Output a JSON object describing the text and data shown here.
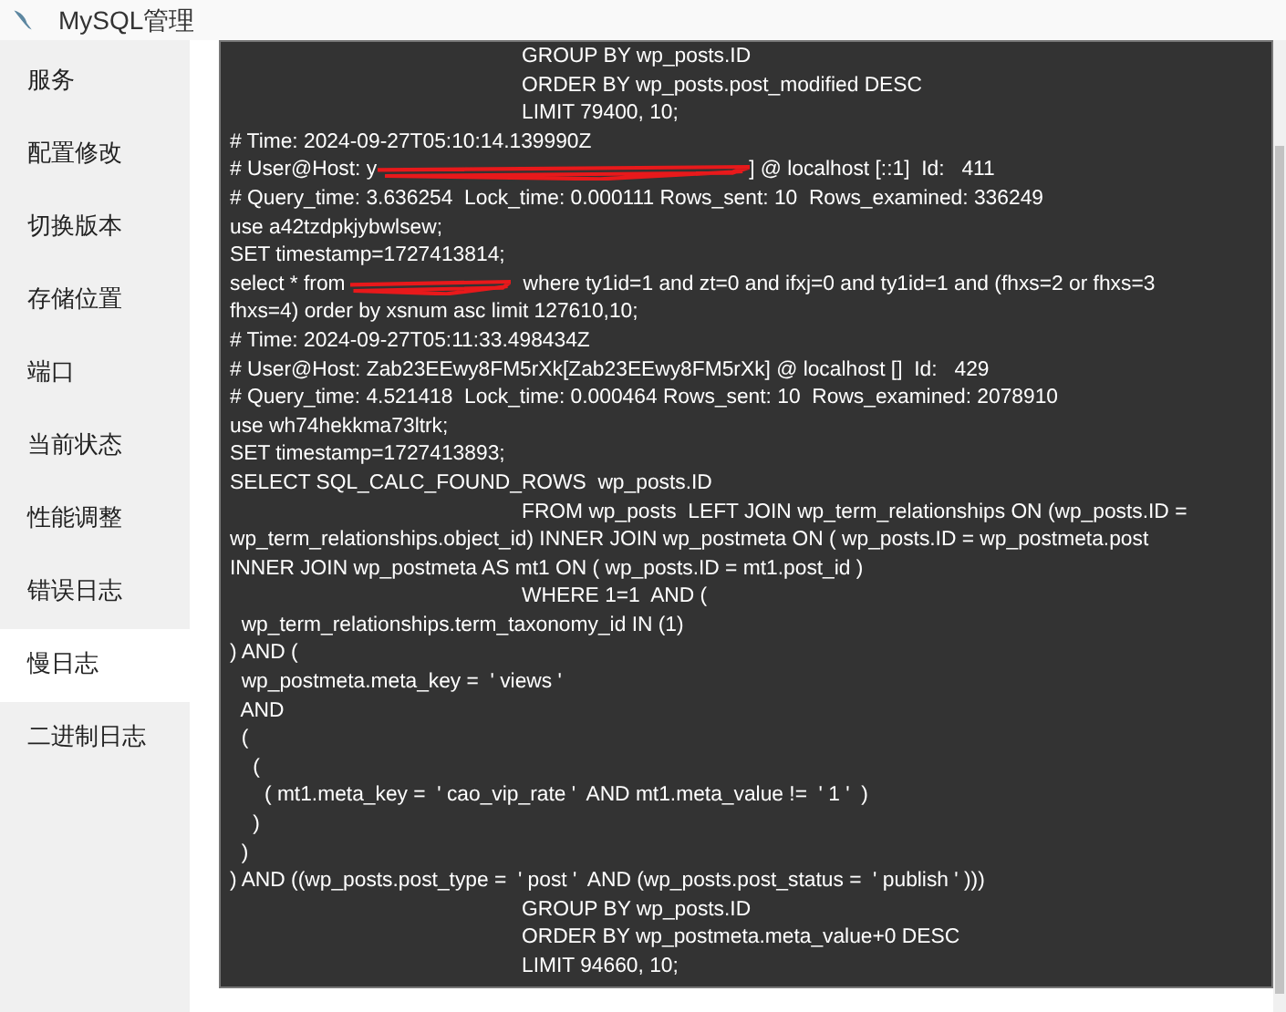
{
  "window": {
    "title": "MySQL管理"
  },
  "sidebar": {
    "items": [
      {
        "label": "服务",
        "selected": false
      },
      {
        "label": "配置修改",
        "selected": false
      },
      {
        "label": "切换版本",
        "selected": false
      },
      {
        "label": "存储位置",
        "selected": false
      },
      {
        "label": "端口",
        "selected": false
      },
      {
        "label": "当前状态",
        "selected": false
      },
      {
        "label": "性能调整",
        "selected": false
      },
      {
        "label": "错误日志",
        "selected": false
      },
      {
        "label": "慢日志",
        "selected": true
      },
      {
        "label": "二进制日志",
        "selected": false
      }
    ]
  },
  "log": {
    "lines": [
      [
        {
          "kind": "text",
          "text": "\t\t\t\tGROUP BY wp_posts.ID"
        }
      ],
      [
        {
          "kind": "text",
          "text": "\t\t\t\tORDER BY wp_posts.post_modified DESC"
        }
      ],
      [
        {
          "kind": "text",
          "text": "\t\t\t\tLIMIT 79400, 10;"
        }
      ],
      [
        {
          "kind": "text",
          "text": "# Time: 2024-09-27T05:10:14.139990Z"
        }
      ],
      [
        {
          "kind": "text",
          "text": "# User@Host: y"
        },
        {
          "kind": "long-redaction"
        },
        {
          "kind": "text",
          "text": "] @ localhost [::1]  Id:   411"
        }
      ],
      [
        {
          "kind": "text",
          "text": "# Query_time: 3.636254  Lock_time: 0.000111 Rows_sent: 10  Rows_examined: 336249"
        }
      ],
      [
        {
          "kind": "text",
          "text": "use a42tzdpkjybwlsew;"
        }
      ],
      [
        {
          "kind": "text",
          "text": "SET timestamp=1727413814;"
        }
      ],
      [
        {
          "kind": "text",
          "text": "select * from "
        },
        {
          "kind": "short-redaction"
        },
        {
          "kind": "text",
          "text": "  where ty1id=1 and zt=0 and ifxj=0 and ty1id=1 and (fhxs=2 or fhxs=3"
        }
      ],
      [
        {
          "kind": "text",
          "text": "fhxs=4) order by xsnum asc limit 127610,10;"
        }
      ],
      [
        {
          "kind": "text",
          "text": "# Time: 2024-09-27T05:11:33.498434Z"
        }
      ],
      [
        {
          "kind": "text",
          "text": "# User@Host: Zab23EEwy8FM5rXk[Zab23EEwy8FM5rXk] @ localhost []  Id:   429"
        }
      ],
      [
        {
          "kind": "text",
          "text": "# Query_time: 4.521418  Lock_time: 0.000464 Rows_sent: 10  Rows_examined: 2078910"
        }
      ],
      [
        {
          "kind": "text",
          "text": "use wh74hekkma73ltrk;"
        }
      ],
      [
        {
          "kind": "text",
          "text": "SET timestamp=1727413893;"
        }
      ],
      [
        {
          "kind": "text",
          "text": "SELECT SQL_CALC_FOUND_ROWS  wp_posts.ID"
        }
      ],
      [
        {
          "kind": "text",
          "text": "\t\t\t\tFROM wp_posts  LEFT JOIN wp_term_relationships ON (wp_posts.ID ="
        }
      ],
      [
        {
          "kind": "text",
          "text": "wp_term_relationships.object_id) INNER JOIN wp_postmeta ON ( wp_posts.ID = wp_postmeta.post"
        }
      ],
      [
        {
          "kind": "text",
          "text": "INNER JOIN wp_postmeta AS mt1 ON ( wp_posts.ID = mt1.post_id )"
        }
      ],
      [
        {
          "kind": "text",
          "text": "\t\t\t\tWHERE 1=1  AND ("
        }
      ],
      [
        {
          "kind": "text",
          "text": "  wp_term_relationships.term_taxonomy_id IN (1)"
        }
      ],
      [
        {
          "kind": "text",
          "text": ") AND ("
        }
      ],
      [
        {
          "kind": "text",
          "text": "  wp_postmeta.meta_key =  ' views '"
        }
      ],
      [
        {
          "kind": "text",
          "text": "  AND"
        }
      ],
      [
        {
          "kind": "text",
          "text": "  ("
        }
      ],
      [
        {
          "kind": "text",
          "text": "    ("
        }
      ],
      [
        {
          "kind": "text",
          "text": "      ( mt1.meta_key =  ' cao_vip_rate '  AND mt1.meta_value !=  ' 1 '  )"
        }
      ],
      [
        {
          "kind": "text",
          "text": "    )"
        }
      ],
      [
        {
          "kind": "text",
          "text": "  )"
        }
      ],
      [
        {
          "kind": "text",
          "text": ") AND ((wp_posts.post_type =  ' post '  AND (wp_posts.post_status =  ' publish ' )))"
        }
      ],
      [
        {
          "kind": "text",
          "text": "\t\t\t\tGROUP BY wp_posts.ID"
        }
      ],
      [
        {
          "kind": "text",
          "text": "\t\t\t\tORDER BY wp_postmeta.meta_value+0 DESC"
        }
      ],
      [
        {
          "kind": "text",
          "text": "\t\t\t\tLIMIT 94660, 10;"
        }
      ]
    ]
  }
}
